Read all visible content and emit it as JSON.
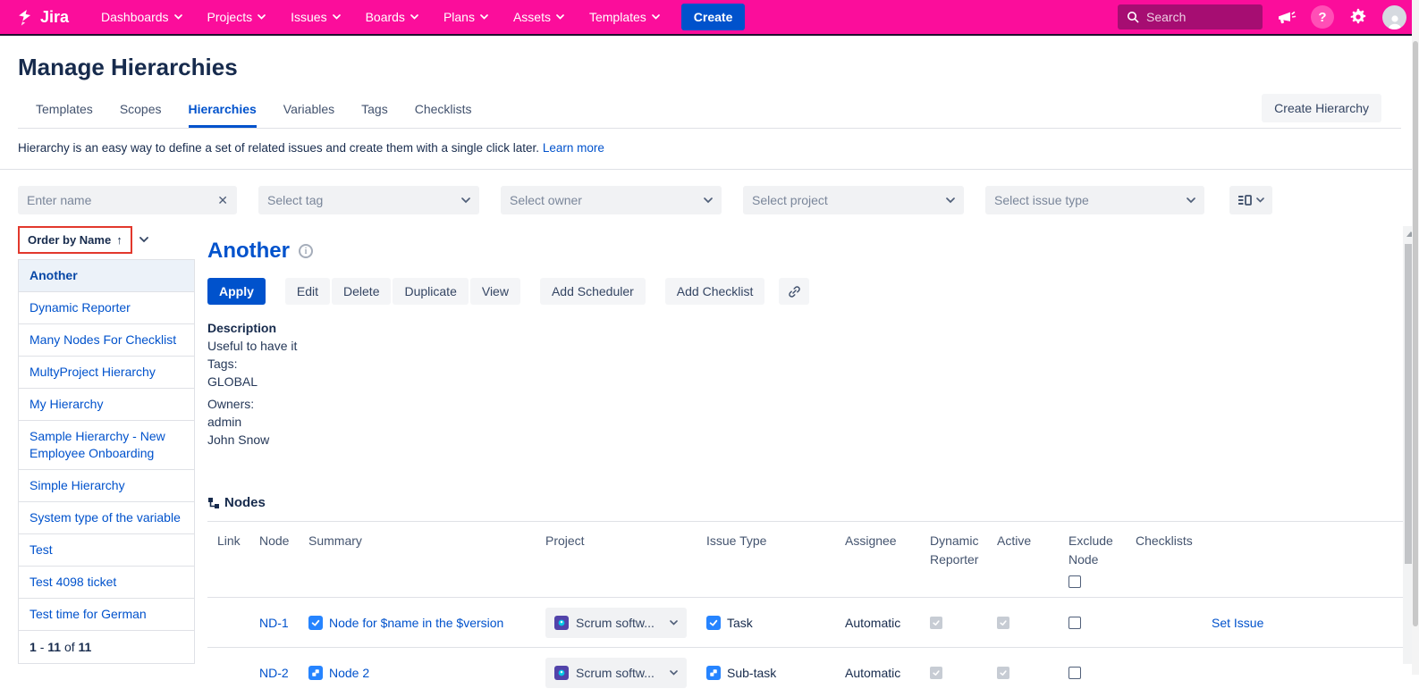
{
  "colors": {
    "nav_pink": "#FB0D9B",
    "nav_search_bg": "#A60D72",
    "accent_blue": "#0052CC",
    "link_blue": "#0052CC",
    "annotation_red": "#E2382C",
    "selected_item_bg": "#ECF2F9",
    "issue_icon_blue": "#2684FF",
    "text_dark": "#172B4D"
  },
  "icons": {
    "jira_logo": "jira-mark",
    "search": "magnifier",
    "megaphone": "announcements",
    "help": "question-circle",
    "gear": "settings",
    "avatar": "user-silhouette",
    "chevron_down": "v",
    "clear": "✕",
    "sort_up_arrow": "↑",
    "info": "i-circle",
    "link": "chain-link",
    "nodes_tree": "hierarchy-tree",
    "layout_toggle": "list-detail-layout",
    "task": "blue-square-white-check",
    "subtask": "blue-square-two-blocks",
    "project_avatar": "purple-square-teal-dot",
    "scroll_up_arrow": "▲"
  },
  "nav": {
    "logo_text": "Jira",
    "items": [
      "Dashboards",
      "Projects",
      "Issues",
      "Boards",
      "Plans",
      "Assets",
      "Templates"
    ],
    "create_label": "Create",
    "search_placeholder": "Search"
  },
  "header": {
    "title": "Manage Hierarchies"
  },
  "tabs": {
    "items": [
      "Templates",
      "Scopes",
      "Hierarchies",
      "Variables",
      "Tags",
      "Checklists"
    ],
    "active": "Hierarchies",
    "create_button": "Create Hierarchy"
  },
  "intro": {
    "text": "Hierarchy is an easy way to define a set of related issues and create them with a single click later.",
    "link": "Learn more"
  },
  "filters": {
    "name_placeholder": "Enter name",
    "tag": "Select tag",
    "owner": "Select owner",
    "project": "Select project",
    "issue_type": "Select issue type"
  },
  "sidebar": {
    "order_label": "Order by Name",
    "order_direction": "↑",
    "selected": "Another",
    "items": [
      "Another",
      "Dynamic Reporter",
      "Many Nodes For Checklist",
      "MultyProject Hierarchy",
      "My Hierarchy",
      "Sample Hierarchy - New Employee Onboarding",
      "Simple Hierarchy",
      "System type of the variable",
      "Test",
      "Test 4098 ticket",
      "Test time for German"
    ],
    "pagination": {
      "from": "1",
      "sep": "-",
      "to": "11",
      "of": "of",
      "total": "11"
    }
  },
  "detail": {
    "title": "Another",
    "actions": {
      "apply": "Apply",
      "edit": "Edit",
      "delete": "Delete",
      "duplicate": "Duplicate",
      "view": "View",
      "add_scheduler": "Add Scheduler",
      "add_checklist": "Add Checklist"
    },
    "description_label": "Description",
    "description": "Useful to have it",
    "tags_label": "Tags:",
    "tags_value": "GLOBAL",
    "owners_label": "Owners:",
    "owner_1": "admin",
    "owner_2": "John Snow"
  },
  "nodes": {
    "title": "Nodes",
    "columns": [
      "Link",
      "Node",
      "Summary",
      "Project",
      "Issue Type",
      "Assignee",
      "Dynamic Reporter",
      "Active",
      "Exclude Node",
      "Checklists"
    ],
    "rows": [
      {
        "node": "ND-1",
        "summary": "Node for $name in the $version",
        "summary_icon": "task-icon",
        "project": "Scrum softw...",
        "issue_type": "Task",
        "issue_type_icon": "task-icon",
        "assignee": "Automatic",
        "dynamic_reporter_checked": "true",
        "active_checked": "true",
        "exclude_checked": "false",
        "checklists_link": "Set Issue"
      },
      {
        "node": "ND-2",
        "summary": "Node 2",
        "summary_icon": "subtask-icon",
        "project": "Scrum softw...",
        "issue_type": "Sub-task",
        "issue_type_icon": "subtask-icon",
        "assignee": "Automatic",
        "dynamic_reporter_checked": "true",
        "active_checked": "true",
        "exclude_checked": "false",
        "checklists_link": ""
      }
    ]
  }
}
